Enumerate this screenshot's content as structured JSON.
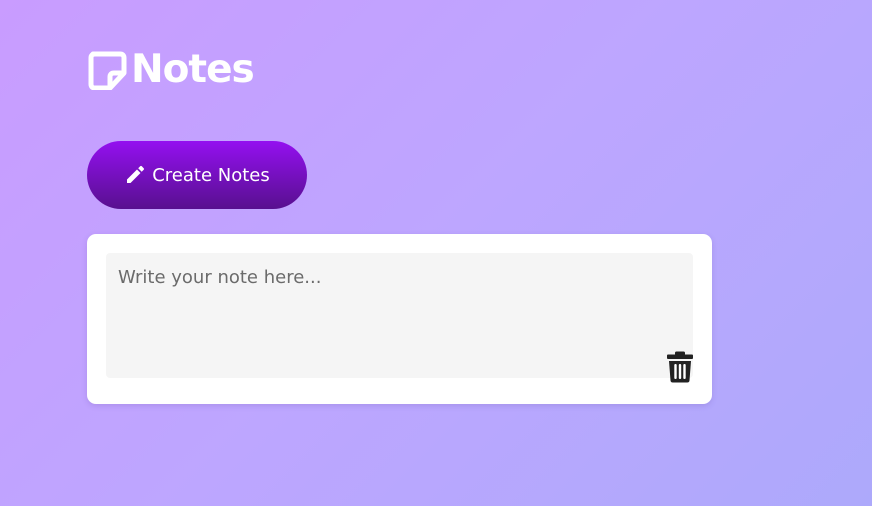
{
  "header": {
    "title": "Notes",
    "icon": "sticky-note-icon"
  },
  "create_button": {
    "label": "Create Notes",
    "icon": "pencil-icon"
  },
  "notes": [
    {
      "placeholder": "Write your note here...",
      "value": "",
      "delete_icon": "trash-icon"
    }
  ],
  "colors": {
    "background_start": "#c99cff",
    "background_end": "#ada9fb",
    "button_top": "#9410f0",
    "button_bottom": "#58108f",
    "card": "#ffffff",
    "input_bg": "#f5f5f5",
    "trash": "#222222"
  }
}
